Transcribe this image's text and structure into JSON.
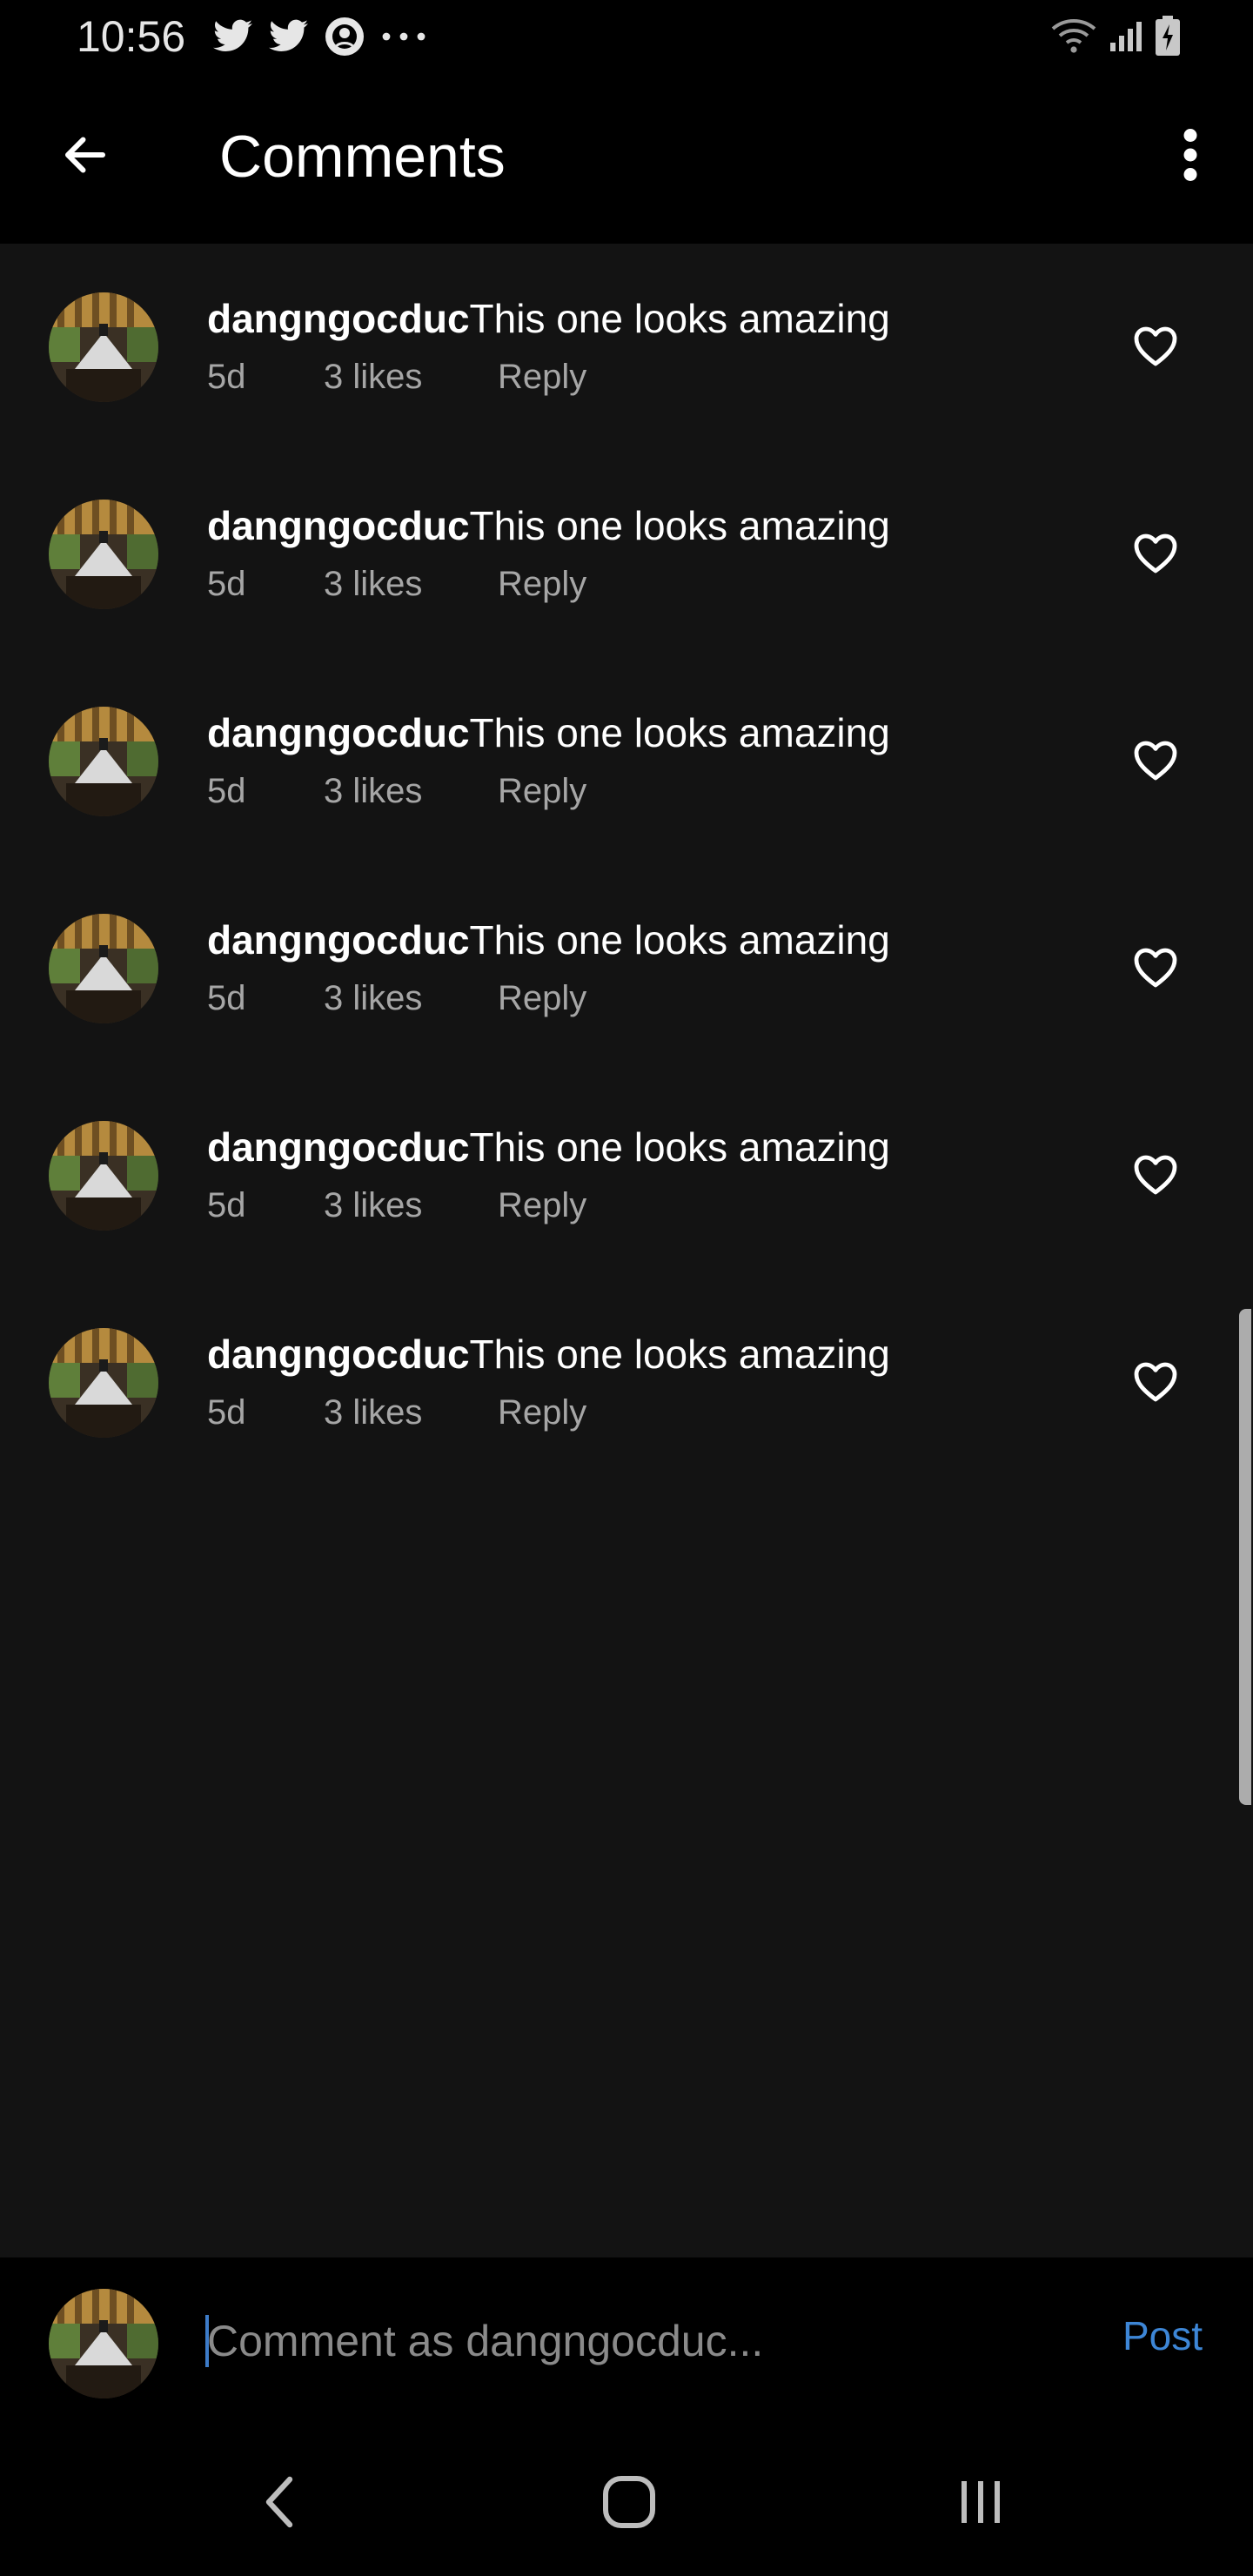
{
  "status_bar": {
    "time": "10:56",
    "left_icons": [
      "twitter-icon",
      "twitter-icon",
      "starbucks-icon",
      "more-notifications-icon"
    ],
    "right_icons": [
      "wifi-icon",
      "signal-icon",
      "battery-charging-icon"
    ]
  },
  "app_bar": {
    "title": "Comments",
    "back_icon": "arrow-back-icon",
    "more_icon": "more-vert-icon"
  },
  "comments": [
    {
      "username": "dangngocduc",
      "text": "This one looks amazing",
      "time": "5d",
      "likes": "3 likes",
      "reply": "Reply"
    },
    {
      "username": "dangngocduc",
      "text": "This one looks amazing",
      "time": "5d",
      "likes": "3 likes",
      "reply": "Reply"
    },
    {
      "username": "dangngocduc",
      "text": "This one looks amazing",
      "time": "5d",
      "likes": "3 likes",
      "reply": "Reply"
    },
    {
      "username": "dangngocduc",
      "text": "This one looks amazing",
      "time": "5d",
      "likes": "3 likes",
      "reply": "Reply"
    },
    {
      "username": "dangngocduc",
      "text": "This one looks amazing",
      "time": "5d",
      "likes": "3 likes",
      "reply": "Reply"
    },
    {
      "username": "dangngocduc",
      "text": "This one looks amazing",
      "time": "5d",
      "likes": "3 likes",
      "reply": "Reply"
    }
  ],
  "composer": {
    "placeholder": "Comment as dangngocduc...",
    "value": "",
    "post_label": "Post"
  },
  "colors": {
    "background": "#131313",
    "bars": "#000000",
    "secondary_text": "#a6a6a6",
    "accent": "#3d86d6"
  }
}
